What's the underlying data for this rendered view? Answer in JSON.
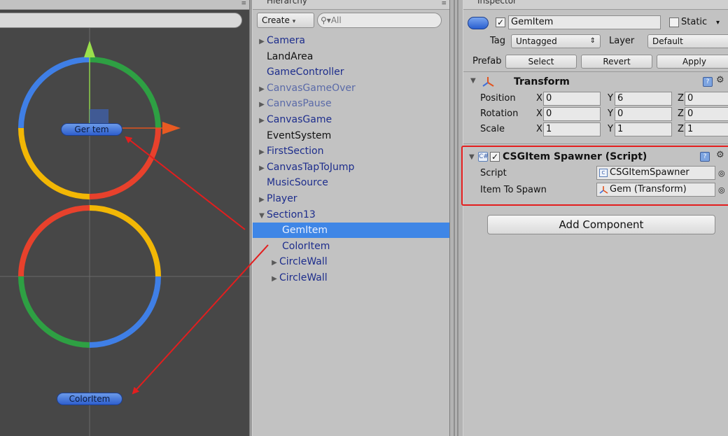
{
  "scene": {
    "labels": {
      "gem_item": "Ger  tem",
      "color_item": "ColorItem"
    },
    "ring_colors": {
      "blue": "#3f7fe6",
      "green": "#2ea043",
      "yellow": "#f2b705",
      "red": "#e8412c"
    }
  },
  "hierarchy": {
    "tab_title": "Hierarchy",
    "create_label": "Create",
    "search_placeholder": "All",
    "items": [
      {
        "label": "Camera",
        "expandable": true,
        "style": "link",
        "indent": 0
      },
      {
        "label": "LandArea",
        "expandable": false,
        "style": "plain",
        "indent": 0
      },
      {
        "label": "GameController",
        "expandable": false,
        "style": "link",
        "indent": 0
      },
      {
        "label": "CanvasGameOver",
        "expandable": true,
        "style": "faded",
        "indent": 0
      },
      {
        "label": "CanvasPause",
        "expandable": true,
        "style": "faded",
        "indent": 0
      },
      {
        "label": "CanvasGame",
        "expandable": true,
        "style": "link",
        "indent": 0
      },
      {
        "label": "EventSystem",
        "expandable": false,
        "style": "plain",
        "indent": 0
      },
      {
        "label": "FirstSection",
        "expandable": true,
        "style": "link",
        "indent": 0
      },
      {
        "label": "CanvasTapToJump",
        "expandable": true,
        "style": "link",
        "indent": 0
      },
      {
        "label": "MusicSource",
        "expandable": false,
        "style": "link",
        "indent": 0
      },
      {
        "label": "Player",
        "expandable": true,
        "style": "link",
        "indent": 0
      },
      {
        "label": "Section13",
        "expandable": true,
        "expanded": true,
        "style": "link",
        "indent": 0
      },
      {
        "label": "GemItem",
        "expandable": false,
        "style": "selected",
        "indent": 1
      },
      {
        "label": "ColorItem",
        "expandable": false,
        "style": "link",
        "indent": 1
      },
      {
        "label": "CircleWall",
        "expandable": true,
        "style": "link",
        "indent": 1
      },
      {
        "label": "CircleWall",
        "expandable": true,
        "style": "link",
        "indent": 1
      }
    ]
  },
  "inspector": {
    "tab_title": "Inspector",
    "object_name": "GemItem",
    "active_checked": true,
    "static_label": "Static",
    "tag_label": "Tag",
    "tag_value": "Untagged",
    "layer_label": "Layer",
    "layer_value": "Default",
    "prefab_label": "Prefab",
    "prefab_buttons": {
      "select": "Select",
      "revert": "Revert",
      "apply": "Apply"
    },
    "transform": {
      "title": "Transform",
      "rows": [
        {
          "label": "Position",
          "x": "0",
          "y": "6",
          "z": "0"
        },
        {
          "label": "Rotation",
          "x": "0",
          "y": "0",
          "z": "0"
        },
        {
          "label": "Scale",
          "x": "1",
          "y": "1",
          "z": "1"
        }
      ],
      "axis_x": "X",
      "axis_y": "Y",
      "axis_z": "Z"
    },
    "spawner": {
      "title": "CSGItem Spawner (Script)",
      "script_label": "Script",
      "script_value": "CSGItemSpawner",
      "item_label": "Item To Spawn",
      "item_value": "Gem (Transform)"
    },
    "add_component": "Add Component"
  },
  "annotation_color": "#e31e1e"
}
